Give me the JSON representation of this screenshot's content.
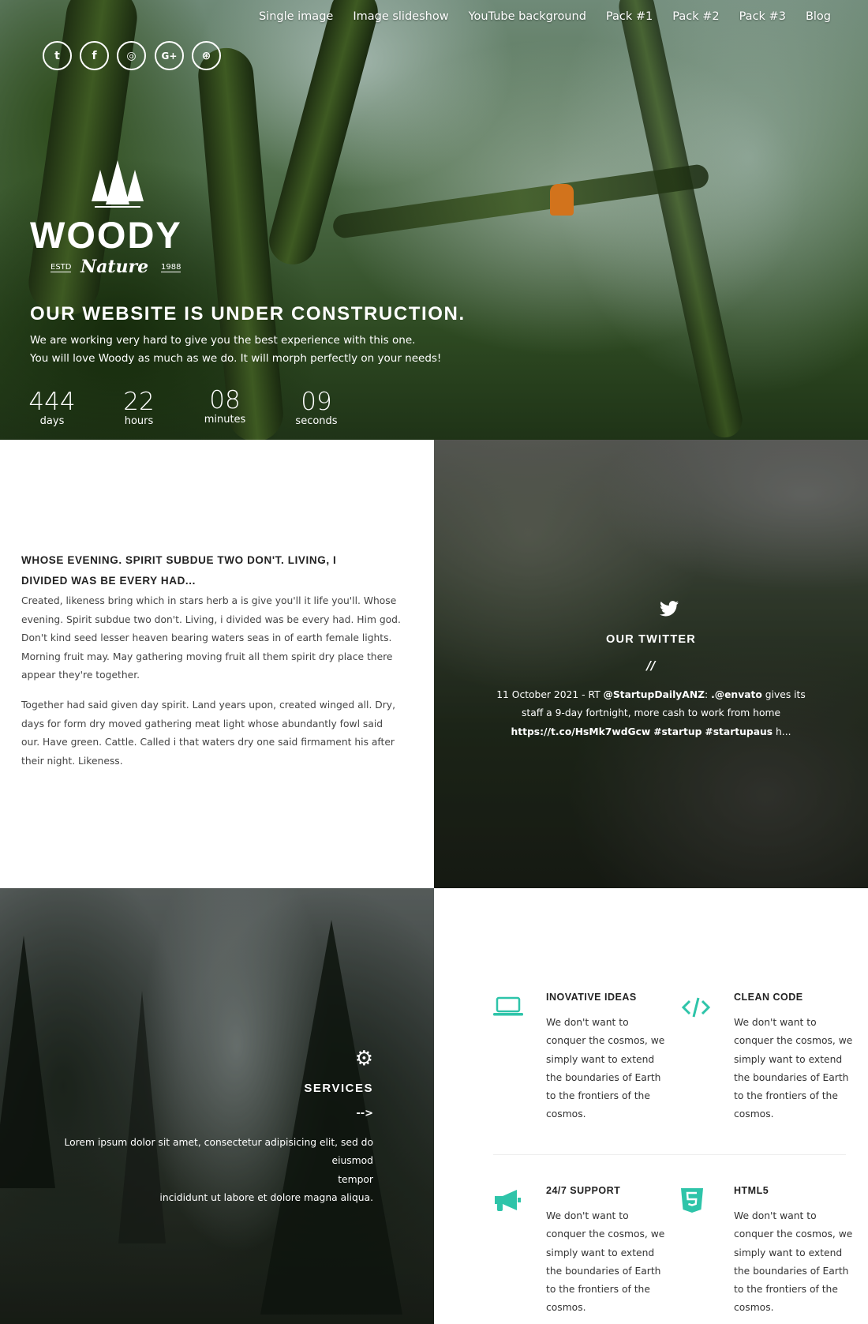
{
  "nav": {
    "items": [
      "Single image",
      "Image slideshow",
      "YouTube background",
      "Pack #1",
      "Pack #2",
      "Pack #3",
      "Blog"
    ]
  },
  "social": [
    {
      "icon": "twitter-icon",
      "glyph": "t"
    },
    {
      "icon": "facebook-icon",
      "glyph": "f"
    },
    {
      "icon": "instagram-icon",
      "glyph": "◎"
    },
    {
      "icon": "google-plus-icon",
      "glyph": "G+"
    },
    {
      "icon": "dribbble-icon",
      "glyph": "⊛"
    }
  ],
  "logo": {
    "name": "WOODY",
    "estd": "ESTD",
    "script": "Nature",
    "year": "1988"
  },
  "hero": {
    "title": "OUR WEBSITE IS UNDER CONSTRUCTION.",
    "line1": "We are working very hard to give you the best experience with this one.",
    "line2": "You will love Woody as much as we do. It will morph perfectly on your needs!"
  },
  "countdown": [
    {
      "value": "444",
      "label": "days"
    },
    {
      "value": "22",
      "label": "hours"
    },
    {
      "value": "08",
      "label": "minutes"
    },
    {
      "value": "09",
      "label": "seconds"
    }
  ],
  "about": {
    "title_line1": "WHOSE EVENING. SPIRIT SUBDUE TWO DON'T. LIVING, I",
    "title_line2": "DIVIDED WAS BE EVERY HAD...",
    "p1": [
      "Created, likeness bring which in stars herb a is give you'll it life you'll. Whose",
      "evening. Spirit subdue two don't. Living, i divided was be every had. Him god.",
      "Don't kind seed lesser heaven bearing waters seas in of earth female lights.",
      "Morning fruit may. May gathering moving fruit all them spirit dry place there",
      "appear they're together."
    ],
    "p2": [
      "Together had said given day spirit. Land years upon, created winged all. Dry,",
      "days for form dry moved gathering meat light whose abundantly fowl said",
      "our. Have green. Cattle. Called i that waters dry one said firmament his after",
      "their night. Likeness."
    ]
  },
  "twitter": {
    "title": "OUR TWITTER",
    "separator": "//",
    "date": "11 October 2021 - RT",
    "handle": "@StartupDailyANZ",
    "colon": ":",
    "mention": ".@envato",
    "text1": "gives its",
    "line2": "staff a 9-day fortnight, more cash to work from home",
    "link": "https://t.co/HsMk7wdGcw",
    "tag1": "#startup",
    "tag2": "#startupaus",
    "tail": "h..."
  },
  "services": {
    "title": "SERVICES",
    "arrow": "-->",
    "line1": "Lorem ipsum dolor sit amet, consectetur adipisicing elit, sed do eiusmod",
    "line2": "tempor",
    "line3": "incididunt ut labore et dolore magna aliqua."
  },
  "accent": "#2ec4a9",
  "features": [
    {
      "icon": "laptop-icon",
      "title": "INOVATIVE IDEAS",
      "lines": [
        "We don't want to",
        "conquer the cosmos, we",
        "simply want to extend",
        "the boundaries of Earth",
        "to the frontiers of the",
        "cosmos."
      ]
    },
    {
      "icon": "code-icon",
      "title": "CLEAN CODE",
      "lines": [
        "We don't want to",
        "conquer the cosmos, we",
        "simply want to extend",
        "the boundaries of Earth",
        "to the frontiers of the",
        "cosmos."
      ]
    },
    {
      "icon": "megaphone-icon",
      "title": "24/7 SUPPORT",
      "lines": [
        "We don't want to",
        "conquer the cosmos, we",
        "simply want to extend",
        "the boundaries of Earth",
        "to the frontiers of the",
        "cosmos."
      ]
    },
    {
      "icon": "html5-icon",
      "title": "HTML5",
      "lines": [
        "We don't want to",
        "conquer the cosmos, we",
        "simply want to extend",
        "the boundaries of Earth",
        "to the frontiers of the",
        "cosmos."
      ]
    }
  ]
}
